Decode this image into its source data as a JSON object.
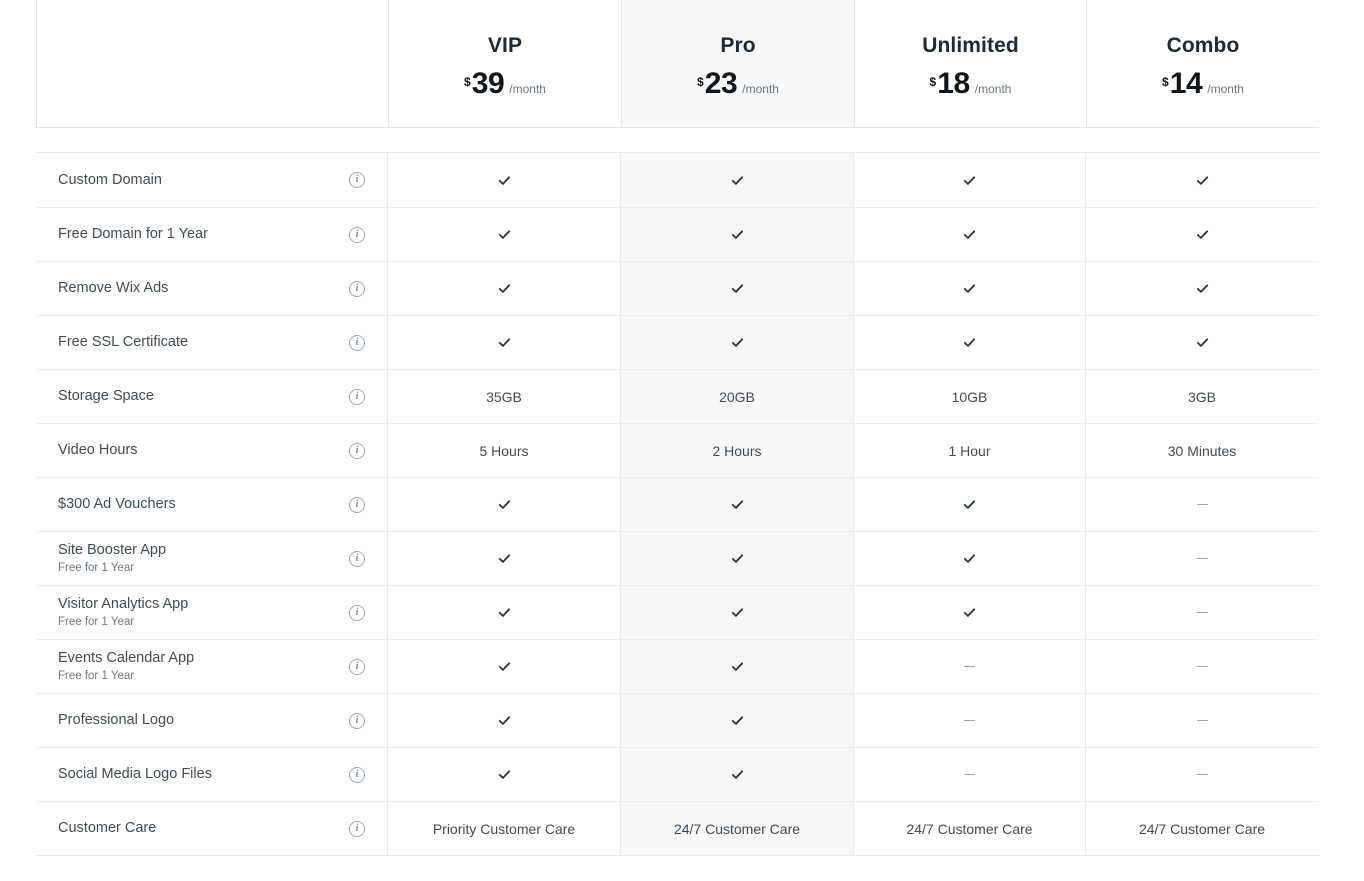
{
  "header": {
    "empty_label": "",
    "plans": [
      {
        "name": "VIP",
        "currency": "$",
        "amount": "39",
        "period": "/month",
        "featured": false
      },
      {
        "name": "Pro",
        "currency": "$",
        "amount": "23",
        "period": "/month",
        "featured": true
      },
      {
        "name": "Unlimited",
        "currency": "$",
        "amount": "18",
        "period": "/month",
        "featured": false
      },
      {
        "name": "Combo",
        "currency": "$",
        "amount": "14",
        "period": "/month",
        "featured": false
      }
    ]
  },
  "info_icon_glyph": "i",
  "features": [
    {
      "label": "Custom Domain",
      "sub": "",
      "values": [
        "check",
        "check",
        "check",
        "check"
      ]
    },
    {
      "label": "Free Domain for 1 Year",
      "sub": "",
      "values": [
        "check",
        "check",
        "check",
        "check"
      ]
    },
    {
      "label": "Remove Wix Ads",
      "sub": "",
      "values": [
        "check",
        "check",
        "check",
        "check"
      ]
    },
    {
      "label": "Free SSL Certificate",
      "sub": "",
      "values": [
        "check",
        "check",
        "check",
        "check"
      ]
    },
    {
      "label": "Storage Space",
      "sub": "",
      "values": [
        "35GB",
        "20GB",
        "10GB",
        "3GB"
      ]
    },
    {
      "label": "Video Hours",
      "sub": "",
      "values": [
        "5 Hours",
        "2 Hours",
        "1 Hour",
        "30 Minutes"
      ]
    },
    {
      "label": "$300 Ad Vouchers",
      "sub": "",
      "values": [
        "check",
        "check",
        "check",
        "dash"
      ]
    },
    {
      "label": "Site Booster App",
      "sub": "Free for 1 Year",
      "values": [
        "check",
        "check",
        "check",
        "dash"
      ]
    },
    {
      "label": "Visitor Analytics App",
      "sub": "Free for 1 Year",
      "values": [
        "check",
        "check",
        "check",
        "dash"
      ]
    },
    {
      "label": "Events Calendar App",
      "sub": "Free for 1 Year",
      "values": [
        "check",
        "check",
        "dash",
        "dash"
      ]
    },
    {
      "label": "Professional Logo",
      "sub": "",
      "values": [
        "check",
        "check",
        "dash",
        "dash"
      ]
    },
    {
      "label": "Social Media Logo Files",
      "sub": "",
      "values": [
        "check",
        "check",
        "dash",
        "dash"
      ]
    },
    {
      "label": "Customer Care",
      "sub": "",
      "values": [
        "Priority Customer Care",
        "24/7 Customer Care",
        "24/7 Customer Care",
        "24/7 Customer Care"
      ]
    }
  ],
  "colors": {
    "plan_name": "#1d2b36",
    "amount": "#10161c",
    "period": "#6b7780",
    "label": "#3e4d58",
    "sublabel": "#6d7a85",
    "check": "#2b3a46",
    "dash": "#9aa6b8",
    "featured_bg": "#f7f8fa",
    "border": "#e8eaed"
  }
}
